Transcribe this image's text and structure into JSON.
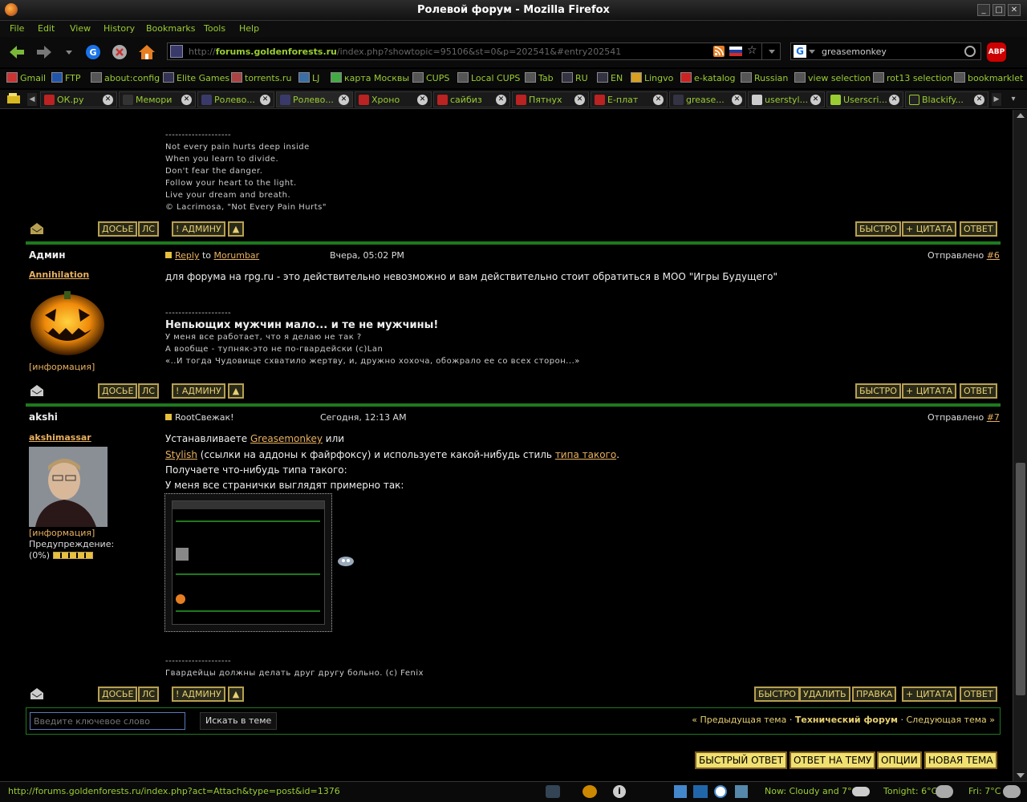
{
  "window": {
    "title": "Ролевой форум - Mozilla Firefox"
  },
  "menu": [
    "File",
    "Edit",
    "View",
    "History",
    "Bookmarks",
    "Tools",
    "Help"
  ],
  "nav": {
    "url_prefix": "http://",
    "url_host": "forums.goldenforests.ru",
    "url_path": "/index.php?showtopic=95106&st=0&p=202541&#entry202541",
    "search_query": "greasemonkey"
  },
  "bookmarks": [
    "Gmail",
    "FTP",
    "about:config",
    "Elite Games",
    "torrents.ru",
    "LJ",
    "карта Москвы",
    "CUPS",
    "Local CUPS",
    "Tab",
    "RU",
    "EN",
    "Lingvo",
    "e-katalog",
    "Russian",
    "view selection",
    "rot13 selection",
    "bookmarklet"
  ],
  "tabs": [
    {
      "label": "ОК.ру"
    },
    {
      "label": "Мемори"
    },
    {
      "label": "Ролево..."
    },
    {
      "label": "Ролево..."
    },
    {
      "label": "Хроно"
    },
    {
      "label": "сайбиз"
    },
    {
      "label": "Пятнух"
    },
    {
      "label": "Е-плат"
    },
    {
      "label": "grease..."
    },
    {
      "label": "userstyl..."
    },
    {
      "label": "Userscri..."
    },
    {
      "label": "Blackify..."
    }
  ],
  "post5_sig": {
    "sep": "--------------------",
    "lines": [
      "Not every pain hurts deep inside",
      "When you learn to divide.",
      "Don't fear the danger.",
      "Follow your heart to the light.",
      "Live your dream and breath.",
      "© Lacrimosa, \"Not Every Pain Hurts\""
    ]
  },
  "buttons": {
    "dossier": "ДОСЬЕ",
    "pm": "ЛС",
    "admin": "! АДМИНУ",
    "quick": "БЫСТРО",
    "quote": "+ ЦИТАТА",
    "reply": "ОТВЕТ",
    "delete": "УДАЛИТЬ",
    "edit": "ПРАВКА"
  },
  "post6": {
    "author": "Админ",
    "group": "Annihilation",
    "reply_word": "Reply",
    "to_word": "to",
    "reply_to": "Morumbar",
    "date": "Вчера, 05:02 PM",
    "sent_label": "Отправлено",
    "num": "#6",
    "info": "[информация]",
    "text": "для форума на rpg.ru - это действительно невозможно и вам действительно стоит обратиться в МОО \"Игры Будущего\"",
    "sig_sep": "--------------------",
    "sig_title": "Непьющих мужчин мало... и те не мужчины!",
    "sig_lines": [
      "У меня все работает, что я делаю не так ?",
      "А вообще - тупняк-это не по-гвардейски (с)Lan",
      "«..И тогда Чудовище схватило жертву, и, дружно хохоча, обожрало ее со всех сторон...»"
    ]
  },
  "post7": {
    "author": "akshi",
    "group": "akshimassar",
    "subject": "RootСвежак!",
    "date": "Сегодня, 12:13 AM",
    "sent_label": "Отправлено",
    "num": "#7",
    "info": "[информация]",
    "warn_label": "Предупреждение:",
    "warn_value": "(0%)",
    "line1_a": "Устанавливаете ",
    "line1_link": "Greasemonkey",
    "line1_b": " или",
    "line2_link": "Stylish",
    "line2_a": " (ссылки на аддоны к файрфоксу) и используете какой-нибудь стиль ",
    "line2_link2": "типа такого",
    "line2_b": ".",
    "line3": "Получаете что-нибудь типа такого:",
    "line4": "У меня все странички выглядят примерно так:",
    "sig_sep": "--------------------",
    "sig": "Гвардейцы должны делать друг другу больно. (с) Fenix"
  },
  "search": {
    "placeholder": "Введите ключевое слово",
    "button": "Искать в теме",
    "prev": "« Предыдущая тема",
    "sep": "·",
    "forum": "Технический форум",
    "next": "Следующая тема »"
  },
  "bottom_buttons": [
    "БЫСТРЫЙ ОТВЕТ",
    "ОТВЕТ НА ТЕМУ",
    "ОПЦИИ",
    "НОВАЯ ТЕМА"
  ],
  "status": {
    "url": "http://forums.goldenforests.ru/index.php?act=Attach&type=post&id=1376",
    "weather_now": "Now: Cloudy and 7°C",
    "weather_tonight": "Tonight: 6°C",
    "weather_fri": "Fri: 7°C"
  },
  "colors": {
    "accent_green": "#9acd32",
    "divider_green": "#1e7a1e",
    "button_gold": "#b8a050",
    "link_orange": "#e8b060"
  }
}
